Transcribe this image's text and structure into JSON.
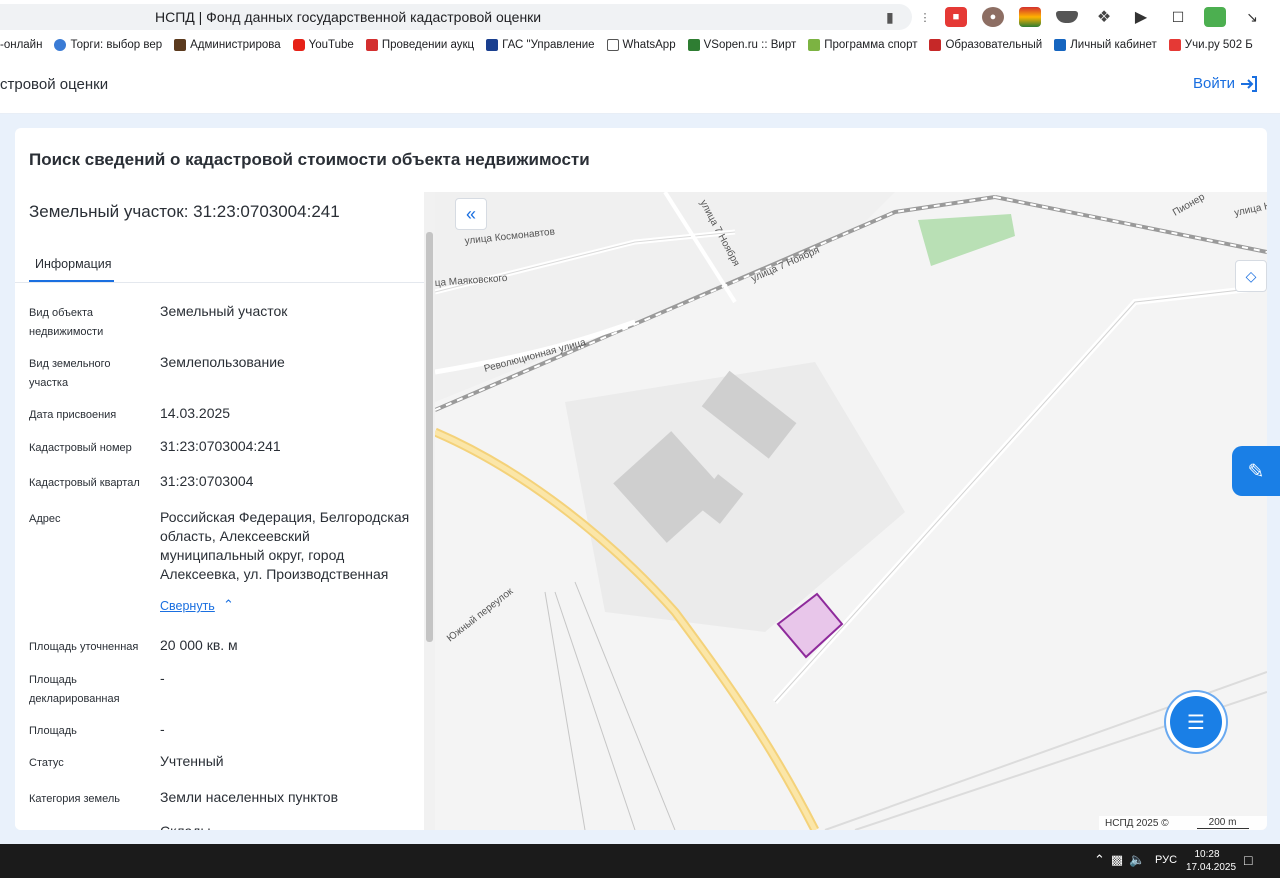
{
  "browser": {
    "tab_title": "НСПД | Фонд данных государственной кадастровой оценки",
    "bookmarks": [
      {
        "label": "-онлайн",
        "color": "#ffffff"
      },
      {
        "label": "Торги: выбор вер",
        "color": "#3a7bd5"
      },
      {
        "label": "Администрирова",
        "color": "#5b3a1e"
      },
      {
        "label": "YouTube",
        "color": "#e62117"
      },
      {
        "label": "Проведении аукц",
        "color": "#d32f2f"
      },
      {
        "label": "ГАС \"Управление",
        "color": "#1a3f8f"
      },
      {
        "label": "WhatsApp",
        "color": "#ffffff"
      },
      {
        "label": "VSopen.ru :: Вирт",
        "color": "#2e7d32"
      },
      {
        "label": "Программа спорт",
        "color": "#7cb342"
      },
      {
        "label": "Образовательный",
        "color": "#c62828"
      },
      {
        "label": "Личный кабинет",
        "color": "#1565c0"
      },
      {
        "label": "Учи.ру 502 Б",
        "color": "#e53935"
      }
    ]
  },
  "header": {
    "brand": "стровой оценки",
    "login": "Войти"
  },
  "card": {
    "title": "Поиск сведений о кадастровой стоимости объекта недвижимости"
  },
  "object": {
    "title": "Земельный участок: 31:23:0703004:241",
    "tab": "Информация",
    "collapse_label": "Свернуть",
    "fields": [
      {
        "label": "Вид объекта недвижимости",
        "value": "Земельный участок"
      },
      {
        "label": "Вид земельного участка",
        "value": "Землепользование"
      },
      {
        "label": "Дата присвоения",
        "value": "14.03.2025"
      },
      {
        "label": "Кадастровый номер",
        "value": "31:23:0703004:241"
      },
      {
        "label": "Кадастровый квартал",
        "value": "31:23:0703004"
      },
      {
        "label": "Адрес",
        "value": "Российская Федерация, Белгородская область, Алексеевский муниципальный округ, город Алексеевка, ул. Производственная"
      },
      {
        "label": "Площадь уточненная",
        "value": "20 000 кв. м"
      },
      {
        "label": "Площадь декларированная",
        "value": "-"
      },
      {
        "label": "Площадь",
        "value": "-"
      },
      {
        "label": "Статус",
        "value": "Учтенный"
      },
      {
        "label": "Категория земель",
        "value": "Земли населенных пунктов"
      },
      {
        "label": "",
        "value": "Склады"
      }
    ]
  },
  "map": {
    "streets": [
      "улица Космонавтов",
      "улица 7 Ноября",
      "улица 7 Ноября",
      "ца Маяковского",
      "Революционная улица",
      "Южный переулок",
      "Пионер",
      "улица Н"
    ],
    "attribution": "НСПД 2025 ©",
    "scale": "200 m"
  },
  "taskbar": {
    "lang": "РУС",
    "time": "10:28",
    "date": "17.04.2025"
  }
}
